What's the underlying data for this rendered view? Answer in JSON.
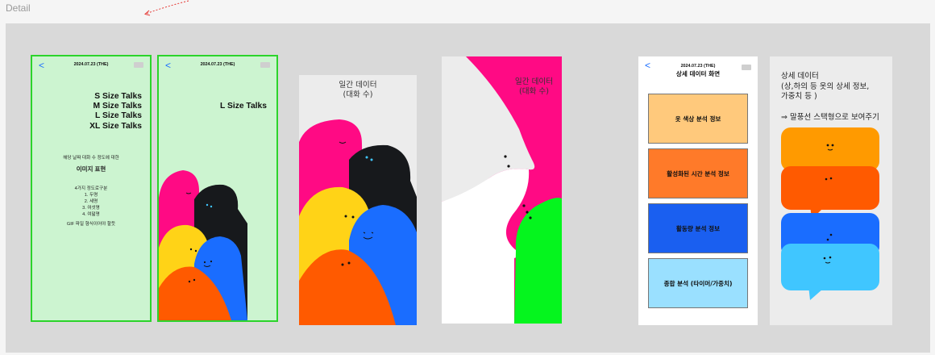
{
  "page": {
    "label": "Detail"
  },
  "colors": {
    "canvas": "#d9d9d9",
    "green_frame_bg": "#ccf4d0",
    "green_frame_border": "#2bd42b",
    "pink": "#ff0a84",
    "black": "#17191c",
    "yellow": "#ffd317",
    "blue": "#1a6dff",
    "orange": "#ff5a00",
    "green": "#05f51e",
    "card_beige": "#ffc97c",
    "card_orange": "#ff7a29",
    "card_blue": "#1a5ff0",
    "card_lightblue": "#9ae0ff",
    "bubble_orange": "#ff9a00",
    "bubble_deep_orange": "#ff5a00",
    "bubble_blue": "#1a6dff",
    "bubble_sky": "#40c6ff"
  },
  "frame1": {
    "back": "<",
    "date": "2024.07.23 (THE)",
    "sizes": [
      "S Size Talks",
      "M Size Talks",
      "L Size Talks",
      "XL Size Talks"
    ],
    "desc_line": "해당 날짜 대화 수 정도에 대한",
    "desc_emphasis": "이미지 표현",
    "levels_title": "4가지 정도로구분",
    "levels": [
      "1. 두명",
      "2. 세명",
      "3. 여섯명",
      "4. 여덟명"
    ],
    "gif_note": "GIF 파일 형식이어야 할듯"
  },
  "frame2": {
    "back": "<",
    "date": "2024.07.23 (THE)",
    "size_label": "L Size Talks"
  },
  "frame3": {
    "title_line1": "일간 데이터",
    "title_line2": "(대화 수)"
  },
  "frame4": {
    "title_line1": "일간 데이터",
    "title_line2": "(대화 수)"
  },
  "frame5": {
    "back": "<",
    "date": "2024.07.23 (THE)",
    "heading": "상세 데이터 화면",
    "cards": [
      "옷 색상 분석 정보",
      "활성화된 시간 분석 정보",
      "활동량 분석 정보",
      "종합 분석 (타이머/가중치)"
    ]
  },
  "frame6": {
    "title": "상세 데이터",
    "line2": "(상,하의 등 옷의 상세 정보,",
    "line3": " 가중치 등 )",
    "note": "⇒ 말풍선 스택형으로 보여주기"
  },
  "icons": [
    "back-chevron-icon",
    "battery-icon",
    "dashed-arrow-icon"
  ]
}
